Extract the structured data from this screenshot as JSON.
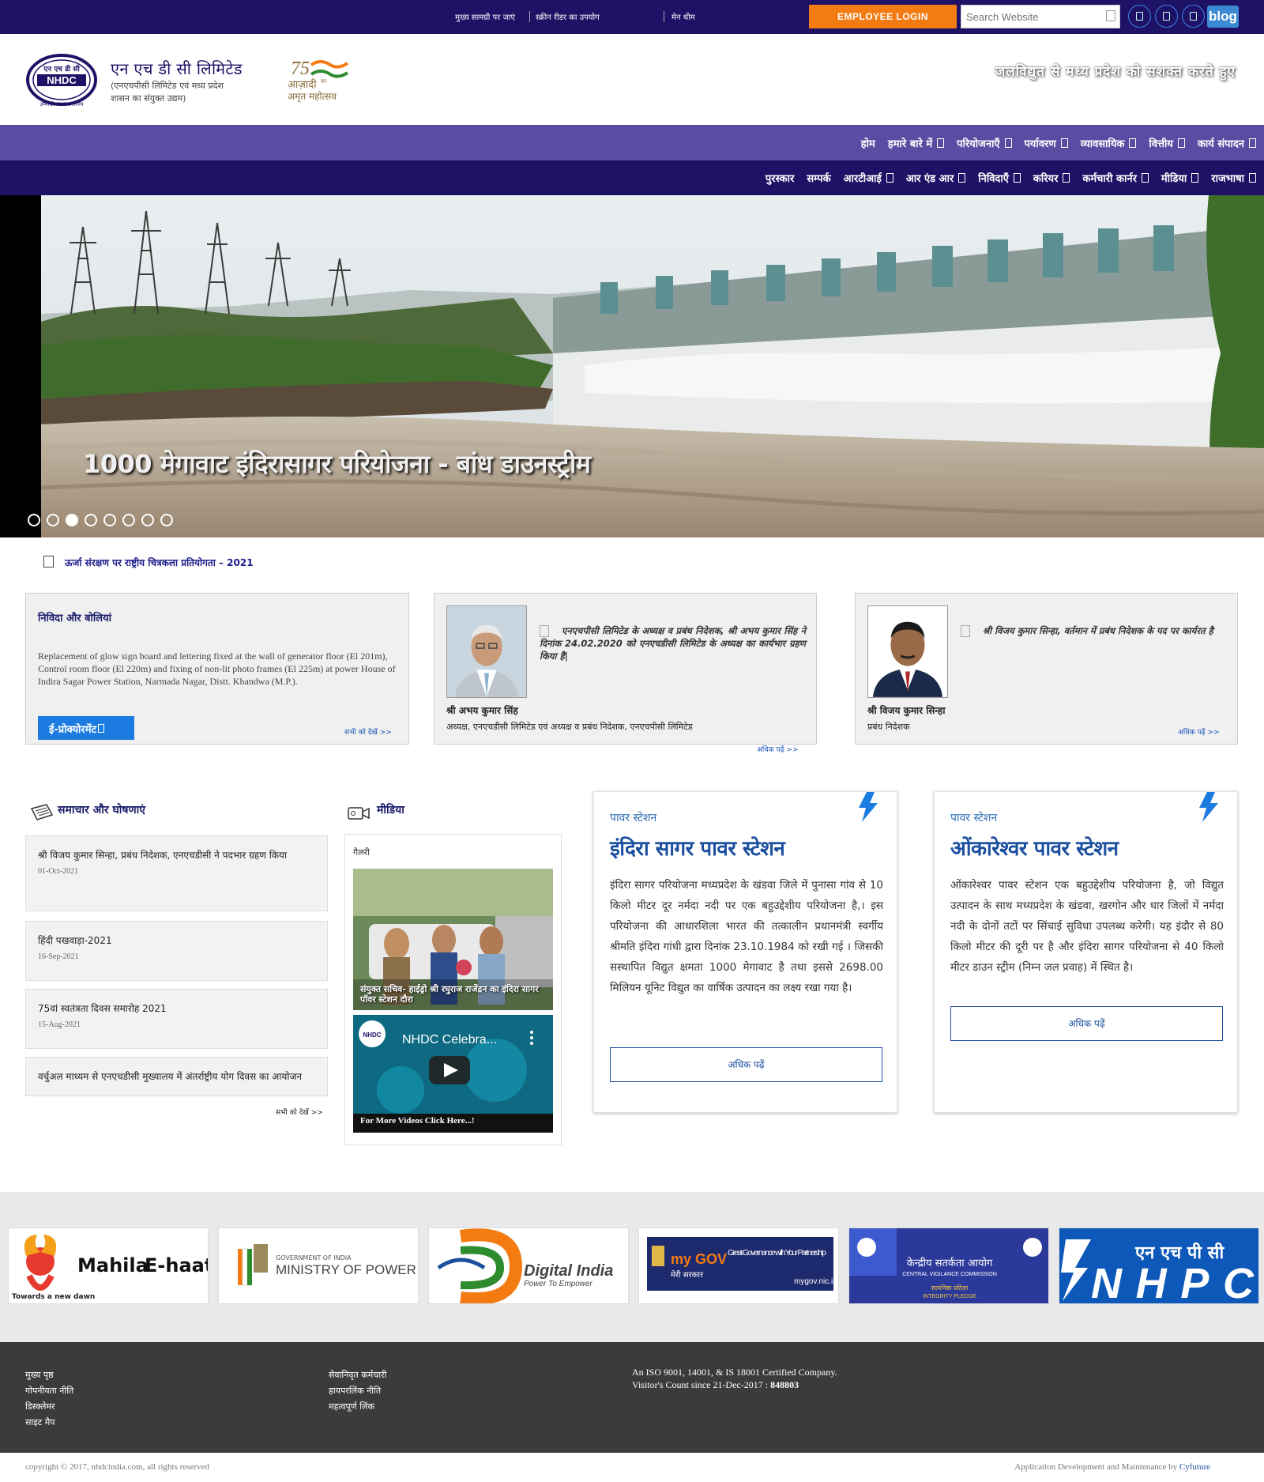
{
  "topbar": {
    "skip_main": "मुख्य सामग्री पर जाएं",
    "screen_reader": "स्क्रीन रीडर का उपयोग",
    "main_theme": "मेन थीम",
    "employee_login": "EMPLOYEE LOGIN",
    "search_placeholder": "Search Website",
    "blog": "blog"
  },
  "header": {
    "org_name": "एन एच डी सी लिमिटेड",
    "org_sub_1": "(एनएचपीसी लिमिटेड एवं मध्य प्रदेश",
    "org_sub_2": "शासन का संयुक्त उद्यम)",
    "logo_text": "NHDC",
    "logo_hindi": "एन एच डी सी",
    "logo_motto": "उम्मीदों का उजालापथ",
    "azadi_line1": "आज़ादी",
    "azadi_sub": "का",
    "azadi_line2": "अमृत महोत्सव",
    "azadi_75": "75",
    "tagline": "जलविद्युत से मध्य प्रदेश को सशक्त करते हुए"
  },
  "nav_primary": [
    {
      "label": "होम",
      "dropdown": false
    },
    {
      "label": "हमारे बारे में",
      "dropdown": true
    },
    {
      "label": "परियोजनाएँ",
      "dropdown": true
    },
    {
      "label": "पर्यावरण",
      "dropdown": true
    },
    {
      "label": "व्यावसायिक",
      "dropdown": true
    },
    {
      "label": "वित्तीय",
      "dropdown": true
    },
    {
      "label": "कार्य संपादन",
      "dropdown": true
    }
  ],
  "nav_secondary": [
    {
      "label": "पुरस्कार",
      "dropdown": false
    },
    {
      "label": "सम्पर्क",
      "dropdown": false
    },
    {
      "label": "आरटीआई",
      "dropdown": true
    },
    {
      "label": "आर एंड आर",
      "dropdown": true
    },
    {
      "label": "निविदाएँ",
      "dropdown": true
    },
    {
      "label": "करियर",
      "dropdown": true
    },
    {
      "label": "कर्मचारी कार्नर",
      "dropdown": true
    },
    {
      "label": "मीडिया",
      "dropdown": true
    },
    {
      "label": "राजभाषा",
      "dropdown": true
    }
  ],
  "hero": {
    "caption": "1000 मेगावाट इंदिरासागर परियोजना - बांध डाउनस्ट्रीम",
    "slide_count": 8,
    "active_slide": 3
  },
  "ticker": {
    "text": "ऊर्जा संरक्षण पर राष्ट्रीय चित्रकला प्रतियोगता – 2021"
  },
  "tenders": {
    "title": "निविदा और बोलियां",
    "text": "Replacement of glow sign board and lettering fixed at the wall of generator floor (El 201m), Control room floor (El 220m) and fixing of non-lit photo frames (El 225m) at power House of Indira Sagar Power Station, Narmada Nagar, Distt. Khandwa (M.P.).",
    "eproc": "ई-प्रोक्योरमेंट",
    "see_all": "सभी को देखें >>"
  },
  "chairman": {
    "quote": "एनएचपीसी लिमिटेड के अध्यक्ष व प्रबंध निदेशक, श्री अभय कुमार सिंह ने दिनांक 24.02.2020 को एनएचडीसी लिमिटेड के अध्यक्ष का कार्यभार ग्रहण किया है|",
    "name": "श्री अभय कुमार सिंह",
    "designation": "अध्यक्ष, एनएचडीसी लिमिटेड एवं अध्यक्ष व प्रबंध निदेशक, एनएचपीसी लिमिटेड",
    "more": "अधिक पढ़ें >>"
  },
  "md": {
    "quote": "श्री विजय कुमार सिन्हा, वर्तमान में प्रबंध निदेशक के पद पर कार्यरत है",
    "name": "श्री विजय कुमार सिन्हा",
    "designation": "प्रबंध निदेशक",
    "more": "अधिक पढ़ें >>"
  },
  "news": {
    "title": "समाचार और घोषणाएं",
    "items": [
      {
        "title": "श्री विजय कुमार सिन्हा, प्रबंध निदेशक, एनएचडीसी ने पदभार ग्रहण किया",
        "date": "01-Oct-2021"
      },
      {
        "title": "हिंदी पखवाड़ा-2021",
        "date": "16-Sep-2021"
      },
      {
        "title": "75वां स्वतंत्रता दिवस समारोह 2021",
        "date": "15-Aug-2021"
      },
      {
        "title": "वर्चुअल माध्यम से एनएचडीसी मुख्यालय में अंतर्राष्ट्रीय योग दिवस का आयोजन",
        "date": ""
      }
    ],
    "see_all": "सभी को देखें >>"
  },
  "media": {
    "title": "मीडिया",
    "gallery_label": "गैलरी",
    "photo_caption": "संयुक्त सचिव- हाईड्रो श्री रघुराज राजेंद्रन का इंदिरा सागर पॉवर स्टेशन दौरा",
    "video_title": "NHDC Celebra...",
    "video_more": "For More Videos Click Here...!"
  },
  "power_stations": [
    {
      "kicker": "पावर स्टेशन",
      "title": "इंदिरा सागर पावर स्टेशन",
      "desc": "इंदिरा सागर परियोजना मध्यप्रदेश के खंडवा जिले में पुनासा गांव से 10 किलो मीटर दूर नर्मदा नदी पर एक बहुउद्देशीय परियोजना है,। इस परियोजना की आधारशिला भारत की तत्कालीन प्रधानमंत्री स्वर्गीय श्रीमति इंदिरा गांधी द्वारा दिनांक 23.10.1984 को रखी गई । जिसकी सस्थापित विद्युत क्षमता 1000 मेगावाट है तथा इससे 2698.00 मिलियन यूनिट विद्युत का वार्षिक उत्पादन का लक्ष्य रखा गया है।",
      "more": "अधिक पढ़ें"
    },
    {
      "kicker": "पावर स्टेशन",
      "title": "ओंकारेश्वर पावर स्टेशन",
      "desc": "ओंकारेश्वर पावर स्टेशन एक बहुउद्देशीय परियोजना है, जो विद्युत उत्पादन के साथ मध्यप्रदेश के खंडवा, खरगोन और धार जिलों में नर्मदा नदी के दोनों तटों पर सिंचाई सुविधा उपलब्ध करेगी। यह इंदौर से 80 किलो मीटर की दूरी पर है और इंदिरा सागर परियोजना से 40 किलो मीटर डाउन स्ट्रीम (निम्न जल प्रवाह) में स्थित है।",
      "more": "अधिक पढ़ें"
    }
  ],
  "partners": {
    "mahila_line1": "Mahila",
    "mahila_line2": "E-haat",
    "mahila_sub": "Towards a new dawn",
    "mop_small": "GOVERNMENT OF INDIA",
    "mop_big": "MINISTRY OF POWER",
    "digital_india": "Digital India",
    "digital_sub": "Power To Empower",
    "mygov_big": "my GOV",
    "mygov_hindi": "मेरी सरकार",
    "mygov_text": "Great Governance with Your Partnership",
    "mygov_url": "mygov.nic.in",
    "cvc_hindi": "केन्द्रीय सतर्कता आयोग",
    "cvc_en": "CENTRAL VIGILANCE COMMISSION",
    "cvc_pledge_hi": "सत्यनिष्ठा प्रतिज्ञा",
    "cvc_pledge_en": "INTEGRITY PLEDGE",
    "nhpc_hindi": "एन एच पी सी",
    "nhpc_en": "NHPC"
  },
  "footer": {
    "col1": [
      "मुख्य पृष्ठ",
      "गोपनीयता नीति",
      "डिस्क्लेमर",
      "साइट मैप"
    ],
    "col2": [
      "सेवानिवृत कर्मचारी",
      "हायपरलिंक नीति",
      "महत्वपूर्ण लिंक"
    ],
    "iso": "An ISO 9001, 14001, & IS 18001 Certified Company.",
    "visitor_label": "Visitor's Count since 21-Dec-2017 :",
    "visitor_count": "848803",
    "copyright": "copyright © 2017, nhdcindia.com, all rights reserved",
    "dev_label": "Application Development and Maintenance by",
    "dev_name": "Cyfuture"
  },
  "colors": {
    "topbar": "#1e1266",
    "nav_primary": "#5c4ba2",
    "accent_orange": "#f47b12",
    "link_blue": "#1c4fa0"
  }
}
